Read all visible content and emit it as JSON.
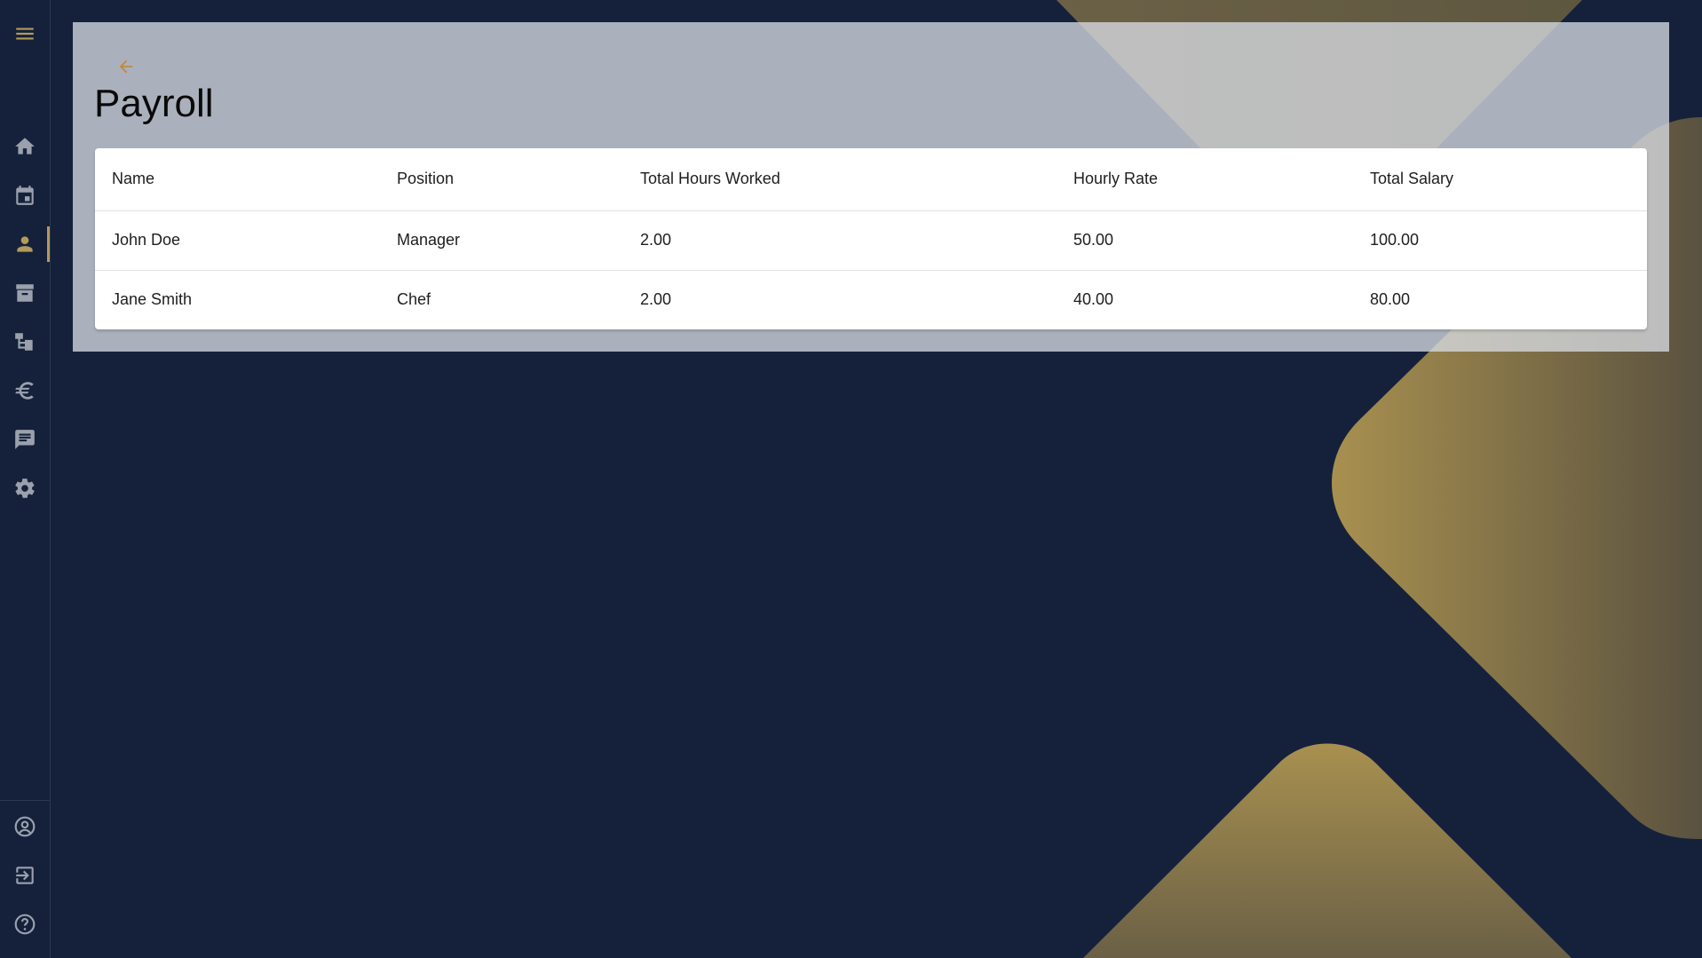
{
  "page": {
    "title": "Payroll"
  },
  "colors": {
    "background": "#15213b",
    "accent": "#b39a5a",
    "panel": "#d6dae0",
    "icon_inactive": "#9aa1ad"
  },
  "sidebar": {
    "top": [
      {
        "icon": "menu-icon",
        "active": false
      },
      {
        "icon": "home-icon",
        "active": false
      },
      {
        "icon": "calendar-icon",
        "active": false
      },
      {
        "icon": "person-icon",
        "active": true
      },
      {
        "icon": "archive-icon",
        "active": false
      },
      {
        "icon": "hierarchy-icon",
        "active": false
      },
      {
        "icon": "euro-icon",
        "active": false
      },
      {
        "icon": "chat-icon",
        "active": false
      },
      {
        "icon": "gear-icon",
        "active": false
      }
    ],
    "bottom": [
      {
        "icon": "account-circle-icon"
      },
      {
        "icon": "logout-icon"
      },
      {
        "icon": "help-icon"
      }
    ]
  },
  "table": {
    "headers": {
      "name": "Name",
      "position": "Position",
      "hours": "Total Hours Worked",
      "rate": "Hourly Rate",
      "salary": "Total Salary"
    },
    "rows": [
      {
        "name": "John Doe",
        "position": "Manager",
        "hours": "2.00",
        "rate": "50.00",
        "salary": "100.00"
      },
      {
        "name": "Jane Smith",
        "position": "Chef",
        "hours": "2.00",
        "rate": "40.00",
        "salary": "80.00"
      }
    ]
  }
}
